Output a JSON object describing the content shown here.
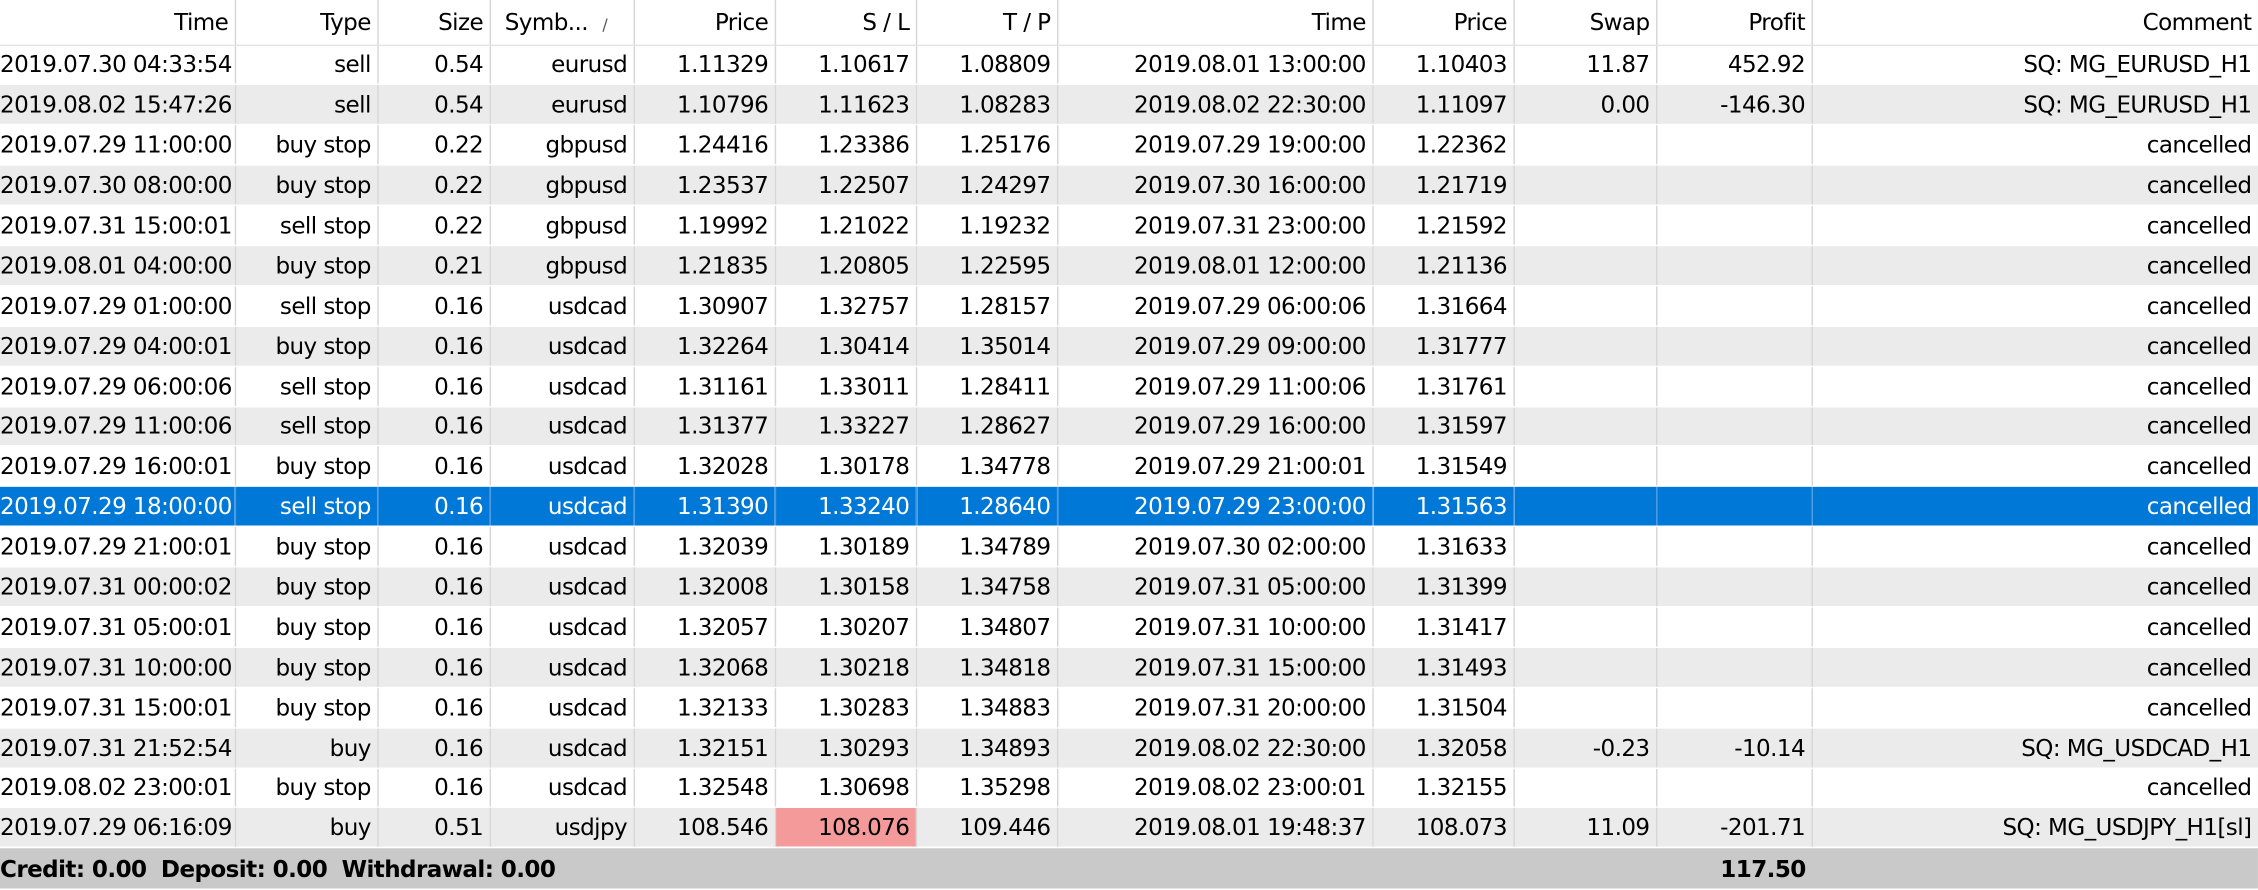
{
  "columns": [
    "Time",
    "Type",
    "Size",
    "Symb...",
    "Price",
    "S / L",
    "T / P",
    "Time",
    "Price",
    "Swap",
    "Profit",
    "Comment"
  ],
  "symbol_sort_indicator": "/",
  "rows": [
    [
      "2019.07.30 04:33:54",
      "sell",
      "0.54",
      "eurusd",
      "1.11329",
      "1.10617",
      "1.08809",
      "2019.08.01 13:00:00",
      "1.10403",
      "11.87",
      "452.92",
      "SQ: MG_EURUSD_H1"
    ],
    [
      "2019.08.02 15:47:26",
      "sell",
      "0.54",
      "eurusd",
      "1.10796",
      "1.11623",
      "1.08283",
      "2019.08.02 22:30:00",
      "1.11097",
      "0.00",
      "-146.30",
      "SQ: MG_EURUSD_H1"
    ],
    [
      "2019.07.29 11:00:00",
      "buy stop",
      "0.22",
      "gbpusd",
      "1.24416",
      "1.23386",
      "1.25176",
      "2019.07.29 19:00:00",
      "1.22362",
      "",
      "",
      "cancelled"
    ],
    [
      "2019.07.30 08:00:00",
      "buy stop",
      "0.22",
      "gbpusd",
      "1.23537",
      "1.22507",
      "1.24297",
      "2019.07.30 16:00:00",
      "1.21719",
      "",
      "",
      "cancelled"
    ],
    [
      "2019.07.31 15:00:01",
      "sell stop",
      "0.22",
      "gbpusd",
      "1.19992",
      "1.21022",
      "1.19232",
      "2019.07.31 23:00:00",
      "1.21592",
      "",
      "",
      "cancelled"
    ],
    [
      "2019.08.01 04:00:00",
      "buy stop",
      "0.21",
      "gbpusd",
      "1.21835",
      "1.20805",
      "1.22595",
      "2019.08.01 12:00:00",
      "1.21136",
      "",
      "",
      "cancelled"
    ],
    [
      "2019.07.29 01:00:00",
      "sell stop",
      "0.16",
      "usdcad",
      "1.30907",
      "1.32757",
      "1.28157",
      "2019.07.29 06:00:06",
      "1.31664",
      "",
      "",
      "cancelled"
    ],
    [
      "2019.07.29 04:00:01",
      "buy stop",
      "0.16",
      "usdcad",
      "1.32264",
      "1.30414",
      "1.35014",
      "2019.07.29 09:00:00",
      "1.31777",
      "",
      "",
      "cancelled"
    ],
    [
      "2019.07.29 06:00:06",
      "sell stop",
      "0.16",
      "usdcad",
      "1.31161",
      "1.33011",
      "1.28411",
      "2019.07.29 11:00:06",
      "1.31761",
      "",
      "",
      "cancelled"
    ],
    [
      "2019.07.29 11:00:06",
      "sell stop",
      "0.16",
      "usdcad",
      "1.31377",
      "1.33227",
      "1.28627",
      "2019.07.29 16:00:00",
      "1.31597",
      "",
      "",
      "cancelled"
    ],
    [
      "2019.07.29 16:00:01",
      "buy stop",
      "0.16",
      "usdcad",
      "1.32028",
      "1.30178",
      "1.34778",
      "2019.07.29 21:00:01",
      "1.31549",
      "",
      "",
      "cancelled"
    ],
    [
      "2019.07.29 18:00:00",
      "sell stop",
      "0.16",
      "usdcad",
      "1.31390",
      "1.33240",
      "1.28640",
      "2019.07.29 23:00:00",
      "1.31563",
      "",
      "",
      "cancelled"
    ],
    [
      "2019.07.29 21:00:01",
      "buy stop",
      "0.16",
      "usdcad",
      "1.32039",
      "1.30189",
      "1.34789",
      "2019.07.30 02:00:00",
      "1.31633",
      "",
      "",
      "cancelled"
    ],
    [
      "2019.07.31 00:00:02",
      "buy stop",
      "0.16",
      "usdcad",
      "1.32008",
      "1.30158",
      "1.34758",
      "2019.07.31 05:00:00",
      "1.31399",
      "",
      "",
      "cancelled"
    ],
    [
      "2019.07.31 05:00:01",
      "buy stop",
      "0.16",
      "usdcad",
      "1.32057",
      "1.30207",
      "1.34807",
      "2019.07.31 10:00:00",
      "1.31417",
      "",
      "",
      "cancelled"
    ],
    [
      "2019.07.31 10:00:00",
      "buy stop",
      "0.16",
      "usdcad",
      "1.32068",
      "1.30218",
      "1.34818",
      "2019.07.31 15:00:00",
      "1.31493",
      "",
      "",
      "cancelled"
    ],
    [
      "2019.07.31 15:00:01",
      "buy stop",
      "0.16",
      "usdcad",
      "1.32133",
      "1.30283",
      "1.34883",
      "2019.07.31 20:00:00",
      "1.31504",
      "",
      "",
      "cancelled"
    ],
    [
      "2019.07.31 21:52:54",
      "buy",
      "0.16",
      "usdcad",
      "1.32151",
      "1.30293",
      "1.34893",
      "2019.08.02 22:30:00",
      "1.32058",
      "-0.23",
      "-10.14",
      "SQ: MG_USDCAD_H1"
    ],
    [
      "2019.08.02 23:00:01",
      "buy stop",
      "0.16",
      "usdcad",
      "1.32548",
      "1.30698",
      "1.35298",
      "2019.08.02 23:00:01",
      "1.32155",
      "",
      "",
      "cancelled"
    ],
    [
      "2019.07.29 06:16:09",
      "buy",
      "0.51",
      "usdjpy",
      "108.546",
      "108.076",
      "109.446",
      "2019.08.01 19:48:37",
      "108.073",
      "11.09",
      "-201.71",
      "SQ: MG_USDJPY_H1[sl]"
    ]
  ],
  "selected_row_index": 11,
  "sl_hit_row_index": 19,
  "footer": {
    "credit_label": "Credit:",
    "credit_value": "0.00",
    "deposit_label": "Deposit:",
    "deposit_value": "0.00",
    "withdrawal_label": "Withdrawal:",
    "withdrawal_value": "0.00",
    "total_profit": "117.50"
  },
  "colors": {
    "selected_row": "#0078d7",
    "alt_row": "#ebebeb",
    "footer_bg": "#c9c9c9",
    "sl_hit": "#f59a9a"
  }
}
